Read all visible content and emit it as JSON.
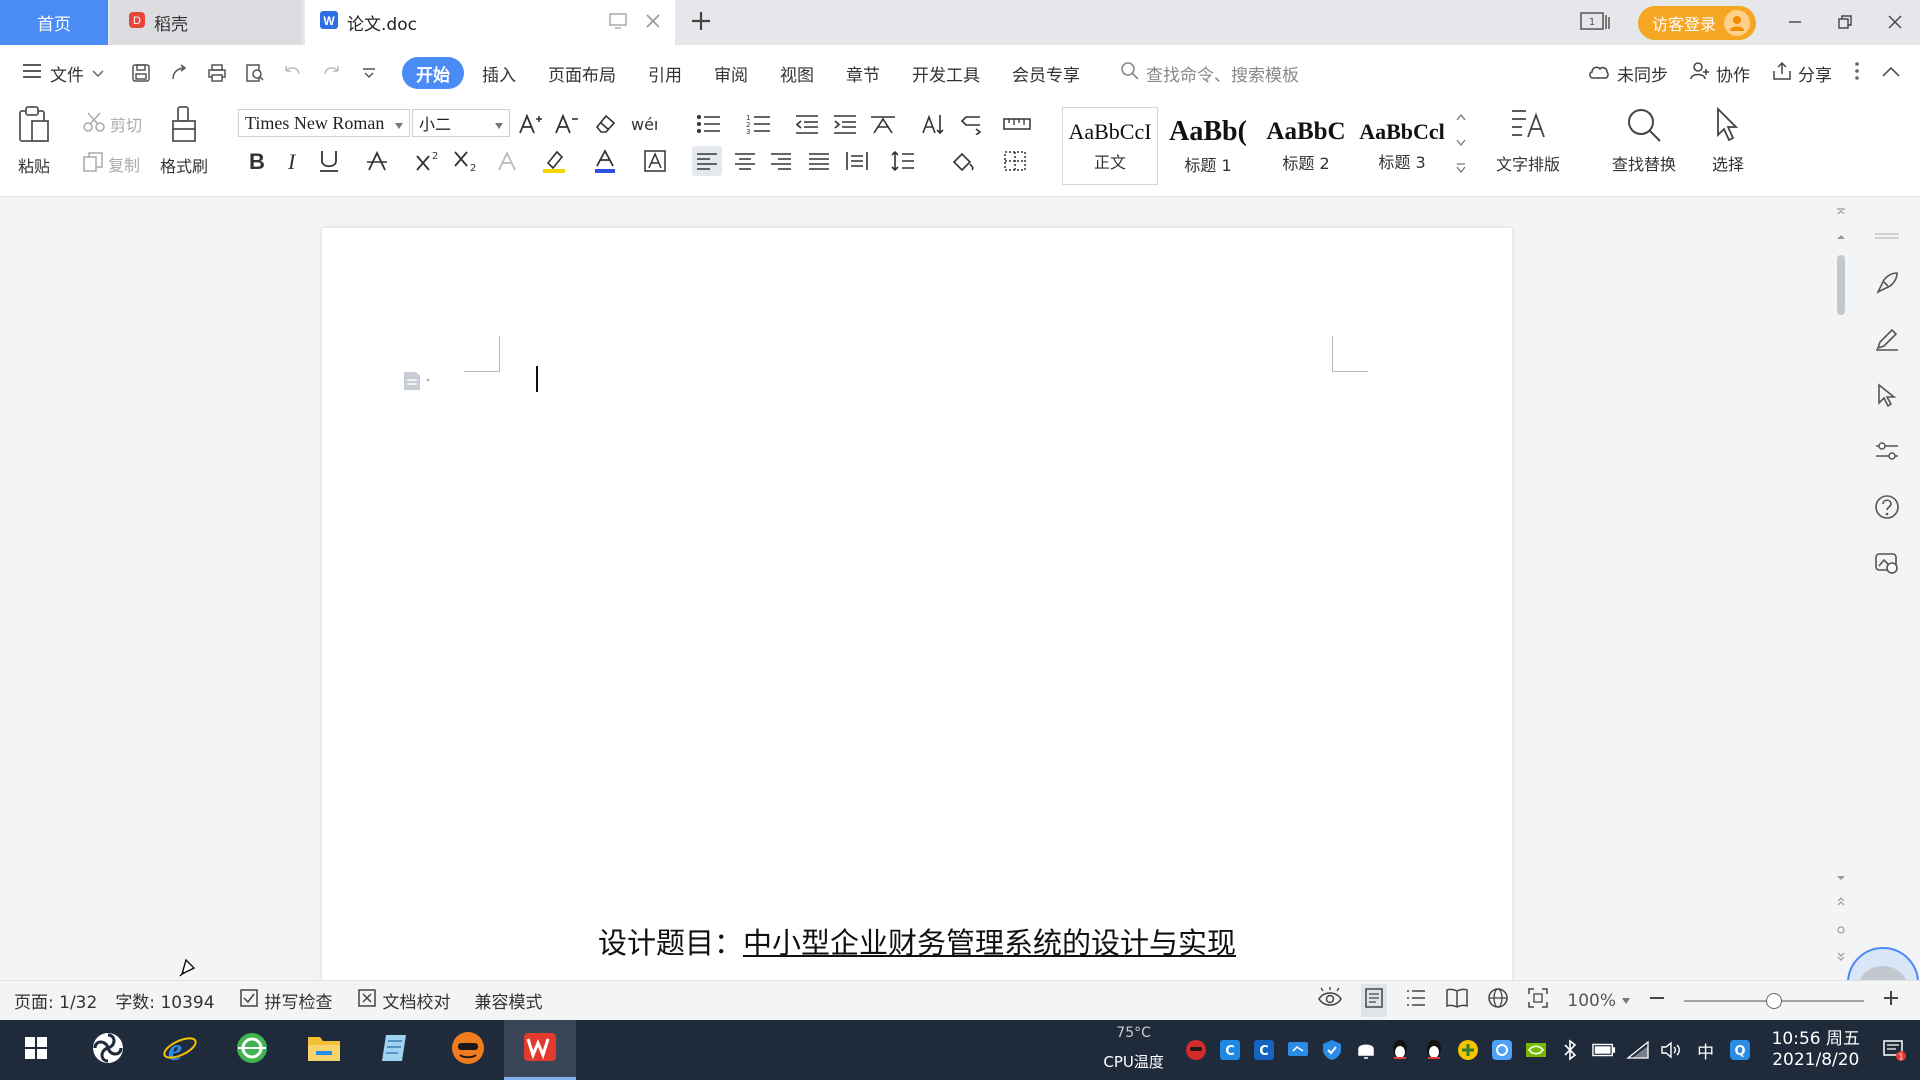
{
  "tabbar": {
    "home_label": "首页",
    "daoke_label": "稻壳",
    "doc_label": "论文.doc",
    "login_label": "访客登录"
  },
  "menu": {
    "file_label": "文件",
    "tabs": [
      "开始",
      "插入",
      "页面布局",
      "引用",
      "审阅",
      "视图",
      "章节",
      "开发工具",
      "会员专享"
    ],
    "search_placeholder": "查找命令、搜索模板",
    "unsync_label": "未同步",
    "collab_label": "协作",
    "share_label": "分享"
  },
  "ribbon": {
    "paste_label": "粘贴",
    "cut_label": "剪切",
    "copy_label": "复制",
    "format_painter_label": "格式刷",
    "font_name": "Times New Roman",
    "font_size": "小二",
    "styles": [
      {
        "sample": "AaBbCcI",
        "label": "正文"
      },
      {
        "sample": "AaBb(",
        "label": "标题 1"
      },
      {
        "sample": "AaBbC",
        "label": "标题 2"
      },
      {
        "sample": "AaBbCcl",
        "label": "标题 3"
      }
    ],
    "text_layout_label": "文字排版",
    "find_replace_label": "查找替换",
    "select_label": "选择"
  },
  "document": {
    "title_prefix": "设计题目：",
    "title_text": "中小型企业财务管理系统的设计与实现"
  },
  "status": {
    "page": "页面: 1/32",
    "word_count": "字数: 10394",
    "spell_check": "拼写检查",
    "doc_proof": "文档校对",
    "compat_mode": "兼容模式",
    "zoom": "100%",
    "zoom_level": 0.5
  },
  "taskbar": {
    "cpu_temp": "75°C",
    "cpu_label": "CPU温度",
    "ime_label": "中",
    "time": "10:56 周五",
    "date": "2021/8/20"
  },
  "colors": {
    "accent": "#4a8bf5",
    "login": "#f5a623",
    "taskbar": "#1f2a3a"
  }
}
